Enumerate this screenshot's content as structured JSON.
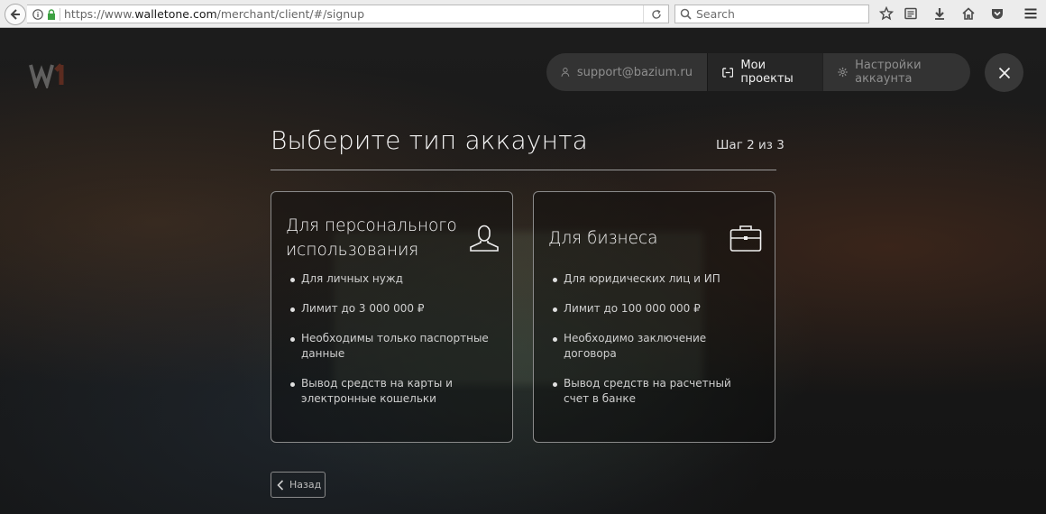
{
  "browser": {
    "url_prefix": "https://www.",
    "url_host": "walletone.com",
    "url_path": "/merchant/client/#/signup",
    "search_placeholder": "Search",
    "icons": [
      "back-arrow-icon",
      "info-icon",
      "lock-icon",
      "reload-icon",
      "search-icon",
      "star-icon",
      "reading-list-icon",
      "download-icon",
      "home-icon",
      "pocket-icon",
      "menu-icon"
    ]
  },
  "header": {
    "email": "support@bazium.ru",
    "projects_label": "Мои проекты",
    "settings_label": "Настройки аккаунта"
  },
  "main": {
    "title": "Выберите тип аккаунта",
    "step": "Шаг 2 из 3",
    "back_label": "Назад"
  },
  "cards": [
    {
      "title": "Для персонального использования",
      "icon": "user-icon",
      "items": [
        "Для личных нужд",
        "Лимит до 3 000 000 ₽",
        "Необходимы только паспортные данные",
        "Вывод средств на карты и электронные кошельки"
      ]
    },
    {
      "title": "Для бизнеса",
      "icon": "briefcase-icon",
      "items": [
        "Для юридических лиц и ИП",
        "Лимит до 100 000 000 ₽",
        "Необходимо заключение договора",
        "Вывод средств на расчетный счет в банке"
      ]
    }
  ],
  "colors": {
    "text_primary": "#f5f5f5",
    "text_muted": "#8e8e8e",
    "card_border": "#8a8a8a",
    "nav_pill": "#373737"
  }
}
